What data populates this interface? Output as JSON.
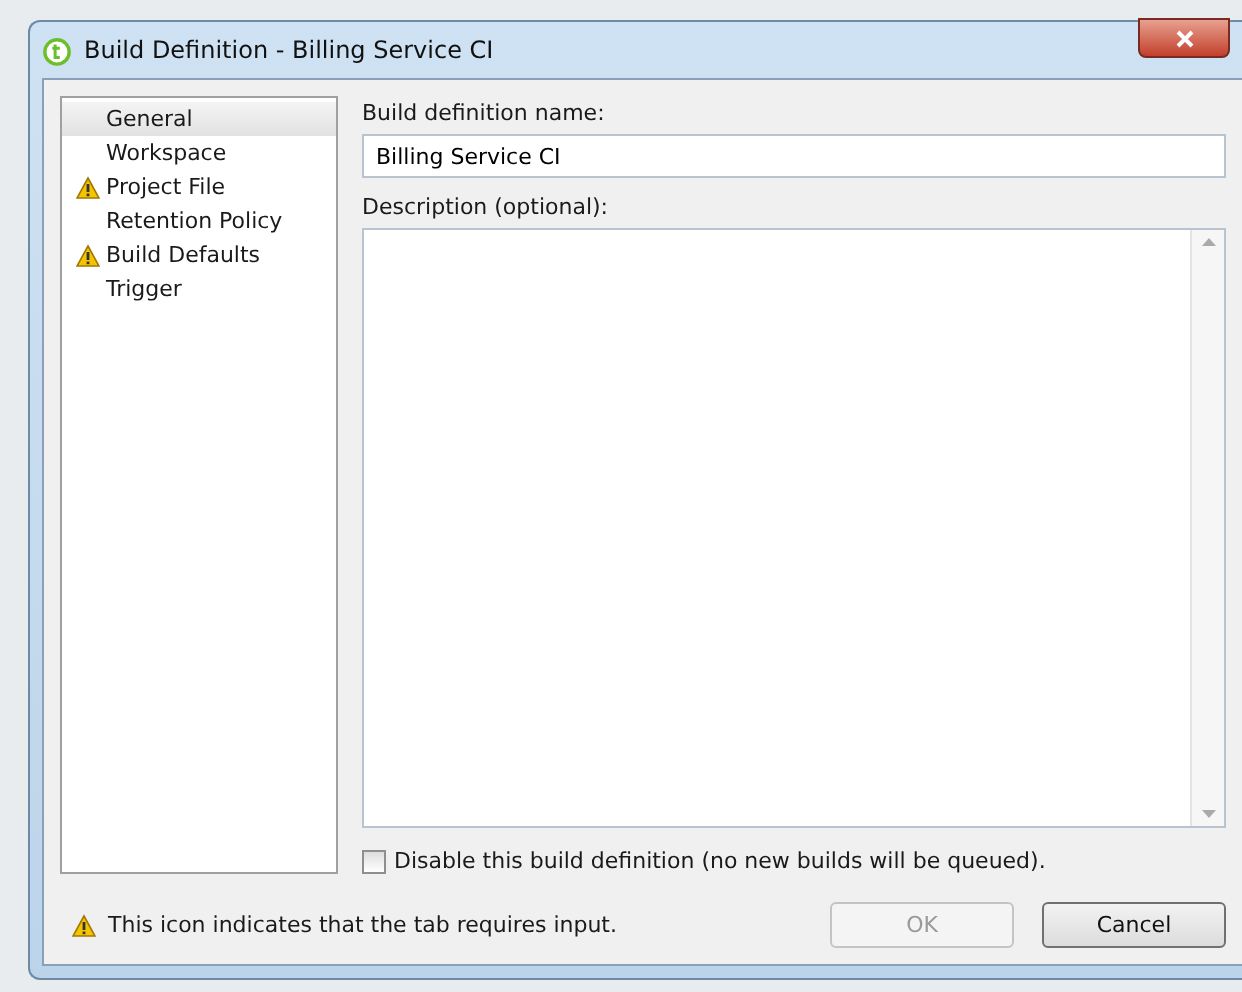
{
  "window": {
    "title": "Build Definition - Billing Service CI"
  },
  "sidebar": {
    "items": [
      {
        "label": "General",
        "selected": true,
        "warning": false
      },
      {
        "label": "Workspace",
        "selected": false,
        "warning": false
      },
      {
        "label": "Project File",
        "selected": false,
        "warning": true
      },
      {
        "label": "Retention Policy",
        "selected": false,
        "warning": false
      },
      {
        "label": "Build Defaults",
        "selected": false,
        "warning": true
      },
      {
        "label": "Trigger",
        "selected": false,
        "warning": false
      }
    ]
  },
  "form": {
    "name_label": "Build definition name:",
    "name_value": "Billing Service CI",
    "description_label": "Description (optional):",
    "disable_label": "Disable this build definition (no new builds will be queued).",
    "disable_checked": false
  },
  "footer": {
    "note": "This icon indicates that the tab requires input.",
    "buttons": [
      {
        "label": "OK",
        "disabled": true
      },
      {
        "label": "Cancel",
        "disabled": false
      }
    ]
  }
}
